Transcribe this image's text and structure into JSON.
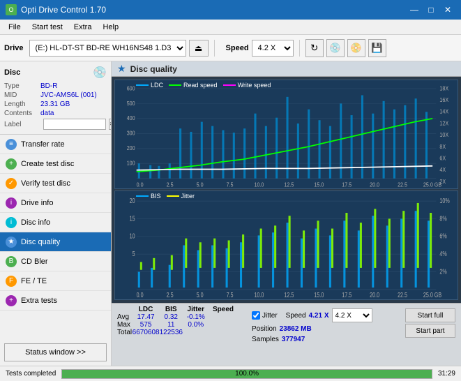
{
  "titleBar": {
    "title": "Opti Drive Control 1.70",
    "minBtn": "—",
    "maxBtn": "□",
    "closeBtn": "✕"
  },
  "menuBar": {
    "items": [
      "File",
      "Start test",
      "Extra",
      "Help"
    ]
  },
  "toolbar": {
    "driveLabel": "Drive",
    "driveValue": "(E:) HL-DT-ST BD-RE  WH16NS48 1.D3",
    "speedLabel": "Speed",
    "speedValue": "4.2 X"
  },
  "discInfo": {
    "title": "Disc",
    "typeLabel": "Type",
    "typeValue": "BD-R",
    "midLabel": "MID",
    "midValue": "JVC-AMS6L (001)",
    "lengthLabel": "Length",
    "lengthValue": "23.31 GB",
    "contentsLabel": "Contents",
    "contentsValue": "data",
    "labelLabel": "Label"
  },
  "navItems": [
    {
      "id": "transfer-rate",
      "label": "Transfer rate",
      "iconColor": "blue"
    },
    {
      "id": "create-test-disc",
      "label": "Create test disc",
      "iconColor": "green"
    },
    {
      "id": "verify-test-disc",
      "label": "Verify test disc",
      "iconColor": "orange"
    },
    {
      "id": "drive-info",
      "label": "Drive info",
      "iconColor": "purple"
    },
    {
      "id": "disc-info",
      "label": "Disc info",
      "iconColor": "teal"
    },
    {
      "id": "disc-quality",
      "label": "Disc quality",
      "iconColor": "blue",
      "active": true
    },
    {
      "id": "cd-bler",
      "label": "CD Bler",
      "iconColor": "green"
    },
    {
      "id": "fe-te",
      "label": "FE / TE",
      "iconColor": "orange"
    },
    {
      "id": "extra-tests",
      "label": "Extra tests",
      "iconColor": "purple"
    }
  ],
  "statusBtn": "Status window >>",
  "chart1": {
    "title": "Disc quality",
    "legend": [
      {
        "id": "ldc",
        "label": "LDC"
      },
      {
        "id": "read",
        "label": "Read speed"
      },
      {
        "id": "write",
        "label": "Write speed"
      }
    ],
    "yMax": 600,
    "yRight": [
      "18 X",
      "16 X",
      "14 X",
      "12 X",
      "10 X",
      "8 X",
      "6 X",
      "4 X",
      "2 X"
    ],
    "xLabels": [
      "0.0",
      "2.5",
      "5.0",
      "7.5",
      "10.0",
      "12.5",
      "15.0",
      "17.5",
      "20.0",
      "22.5",
      "25.0 GB"
    ]
  },
  "chart2": {
    "legend": [
      {
        "id": "bis",
        "label": "BIS"
      },
      {
        "id": "jitter",
        "label": "Jitter"
      }
    ],
    "yMax": 20,
    "yRight": [
      "10%",
      "8%",
      "6%",
      "4%",
      "2%"
    ],
    "xLabels": [
      "0.0",
      "2.5",
      "5.0",
      "7.5",
      "10.0",
      "12.5",
      "15.0",
      "17.5",
      "20.0",
      "22.5",
      "25.0 GB"
    ]
  },
  "stats": {
    "headers": [
      "",
      "LDC",
      "BIS",
      "",
      "Jitter",
      "Speed",
      ""
    ],
    "avgLabel": "Avg",
    "avgLdc": "17.47",
    "avgBis": "0.32",
    "avgJitter": "-0.1%",
    "avgSpeed": "",
    "maxLabel": "Max",
    "maxLdc": "575",
    "maxBis": "11",
    "maxJitter": "0.0%",
    "totalLabel": "Total",
    "totalLdc": "6670608",
    "totalBis": "122536",
    "jitterChecked": true,
    "jitterLabel": "Jitter",
    "speedLabel": "Speed",
    "speedValue": "4.21 X",
    "speedSelectValue": "4.2 X",
    "positionLabel": "Position",
    "positionValue": "23862 MB",
    "samplesLabel": "Samples",
    "samplesValue": "377947",
    "startFullBtn": "Start full",
    "startPartBtn": "Start part"
  },
  "statusBar": {
    "statusText": "Tests completed",
    "progressValue": "100.0",
    "progressLabel": "100.0%",
    "timeLabel": "31:29"
  }
}
